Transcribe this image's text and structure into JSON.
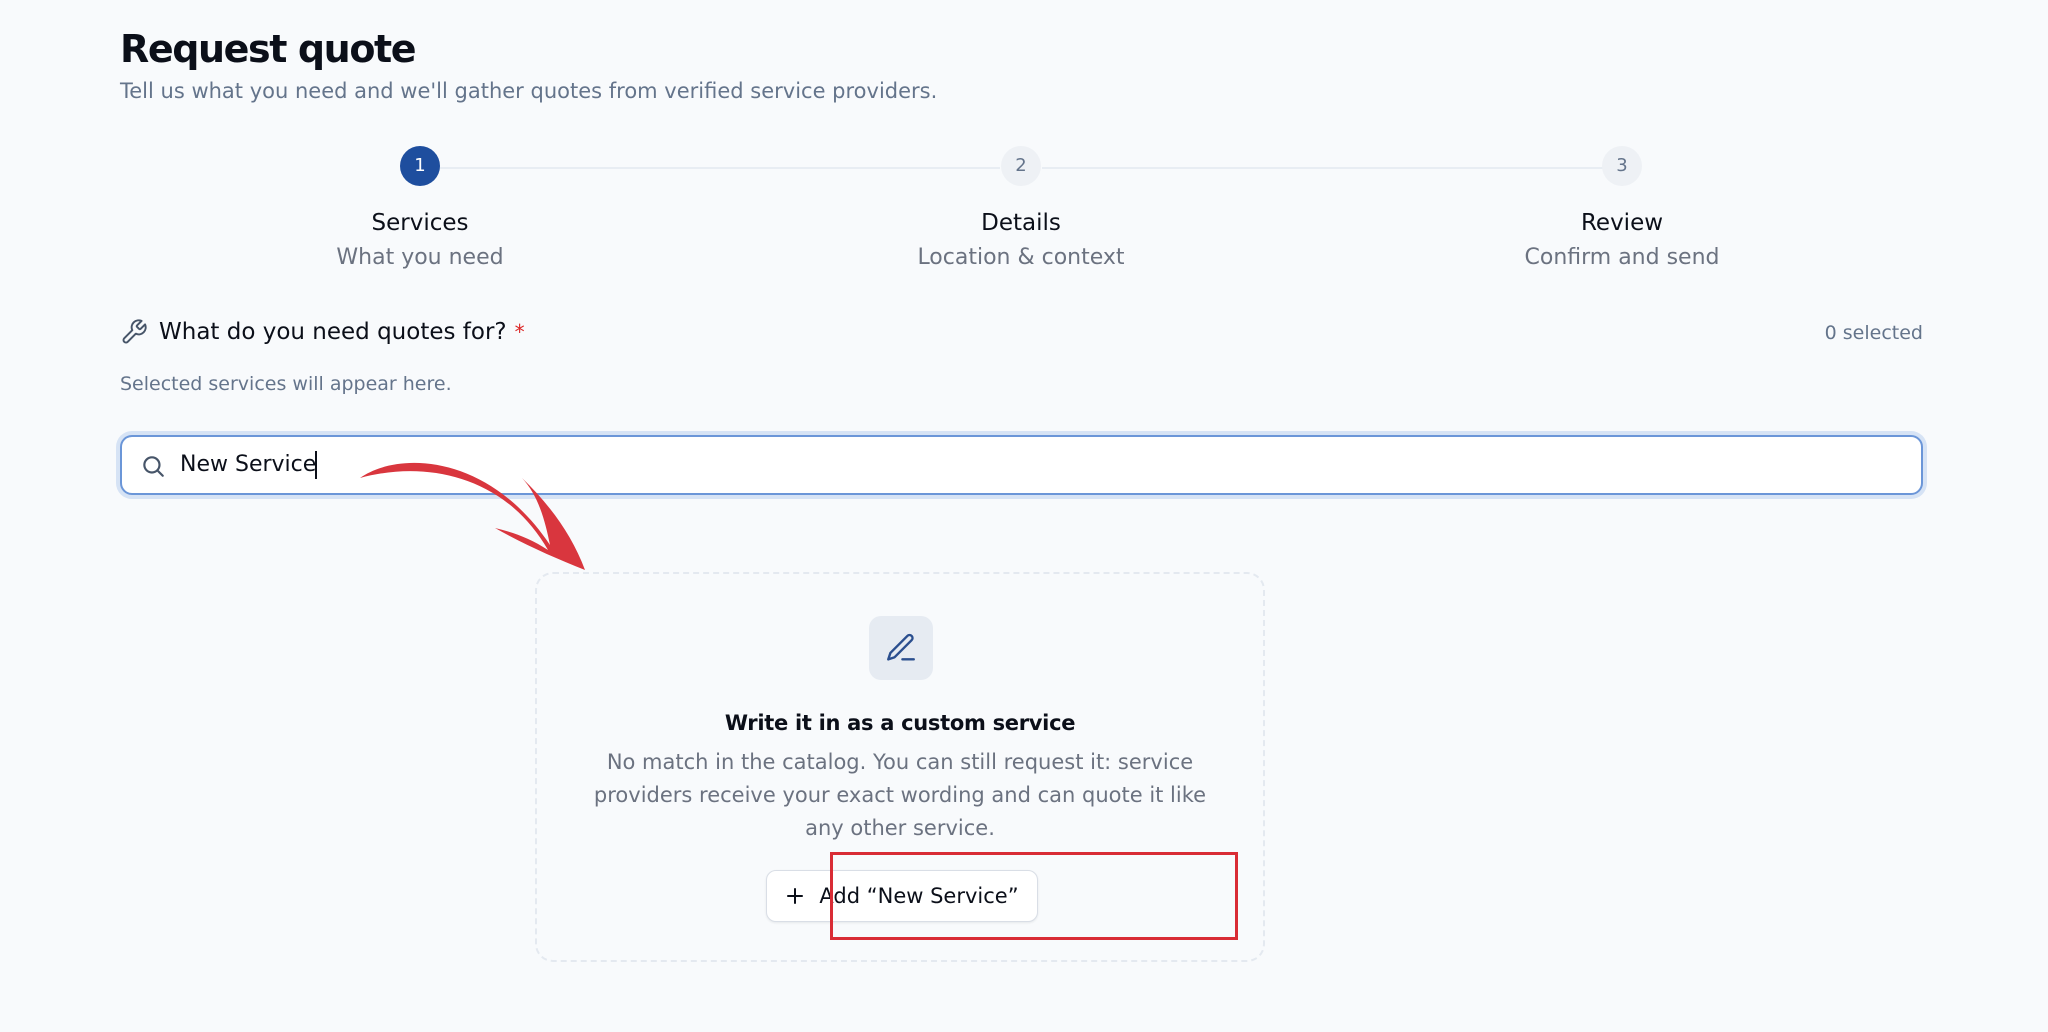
{
  "header": {
    "title": "Request quote",
    "subtitle": "Tell us what you need and we'll gather quotes from verified service providers."
  },
  "stepper": {
    "steps": [
      {
        "number": "1",
        "title": "Services",
        "subtitle": "What you need",
        "state": "active"
      },
      {
        "number": "2",
        "title": "Details",
        "subtitle": "Location & context",
        "state": "upcoming"
      },
      {
        "number": "3",
        "title": "Review",
        "subtitle": "Confirm and send",
        "state": "upcoming"
      }
    ]
  },
  "services": {
    "question": "What do you need quotes for?",
    "required_mark": "*",
    "selected_count": "0 selected",
    "empty_hint": "Selected services will appear here.",
    "icon": "wrench-icon"
  },
  "search": {
    "value": "New Service",
    "icon": "search-icon"
  },
  "custom_service": {
    "icon": "pen-icon",
    "title": "Write it in as a custom service",
    "description": "No match in the catalog. You can still request it: service providers receive your exact wording and can quote it like any other service.",
    "add_button_label": "Add “New Service”",
    "add_button_icon": "plus-icon"
  },
  "annotations": {
    "arrow_color": "#d9363e",
    "highlight_color": "#d92c35"
  },
  "colors": {
    "accent": "#1e4e9e",
    "focus_ring": "#6b96d8",
    "required": "#dc2626"
  }
}
